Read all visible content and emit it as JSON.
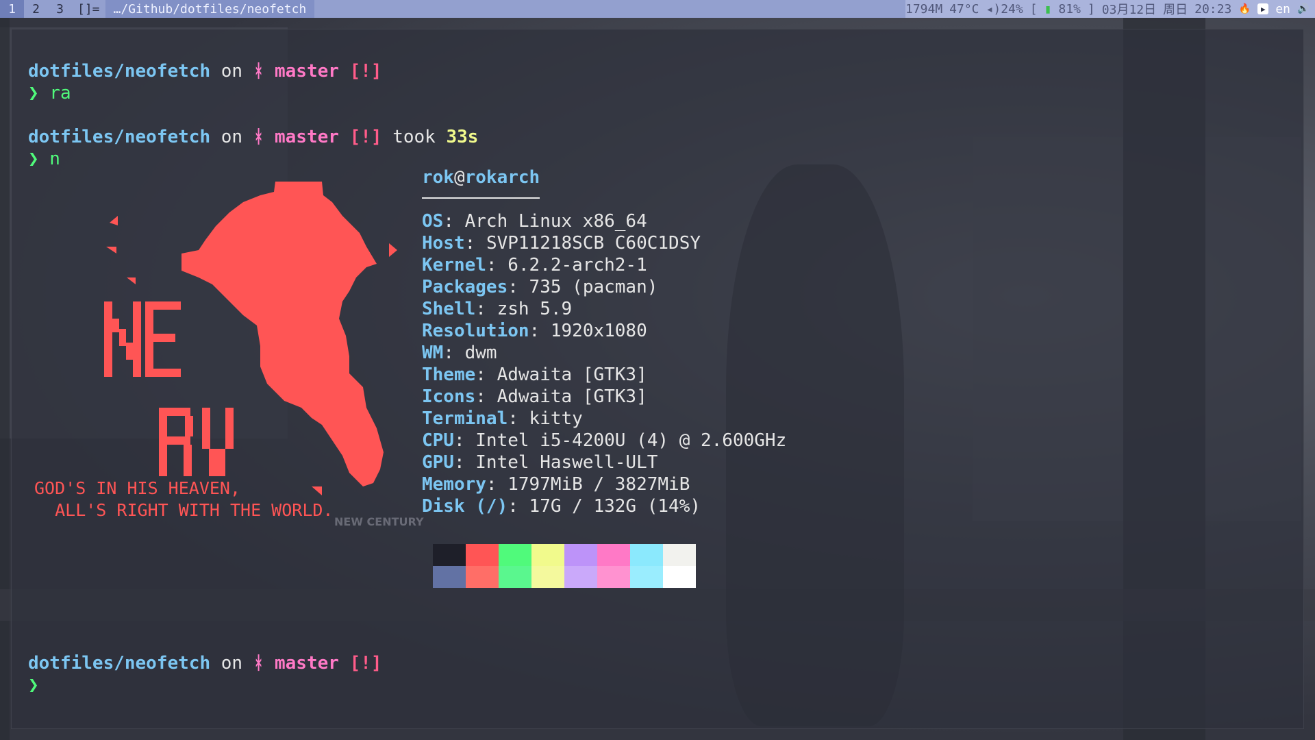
{
  "topbar": {
    "tags": [
      "1",
      "2",
      "3"
    ],
    "active_tag": "1",
    "layout_symbol": "[]=",
    "window_title": "…/Github/dotfiles/neofetch",
    "memory": "1794M",
    "temperature": "47°C",
    "volume": "◂)24%",
    "battery_open": "[",
    "battery": "81%",
    "battery_close": "]",
    "date": "03月12日",
    "weekday": "周日",
    "time": "20:23",
    "lang": "en",
    "icons": {
      "fire": "fire-icon",
      "play": "play-icon",
      "volume": "volume-icon",
      "battery": "battery-icon"
    }
  },
  "terminal": {
    "prompt1": {
      "dir": "dotfiles/neofetch",
      "on": " on ",
      "branch_icon": "ᚼ",
      "branch": " master",
      "status": " [!]"
    },
    "cmd1": {
      "prompt": "❯",
      "text": " ra"
    },
    "prompt2": {
      "dir": "dotfiles/neofetch",
      "on": " on ",
      "branch_icon": "ᚼ",
      "branch": " master",
      "status": " [!]",
      "took": " took ",
      "time": "33s"
    },
    "cmd2": {
      "prompt": "❯",
      "text": " n"
    },
    "prompt3": {
      "dir": "dotfiles/neofetch",
      "on": " on ",
      "branch_icon": "ᚼ",
      "branch": " master",
      "status": " [!]"
    },
    "cmd3": {
      "prompt": "❯",
      "text": ""
    }
  },
  "neofetch": {
    "user": "rok",
    "at": "@",
    "host": "rokarch",
    "rows": [
      {
        "key": "OS",
        "value": "Arch Linux x86_64"
      },
      {
        "key": "Host",
        "value": "SVP11218SCB C60C1DSY"
      },
      {
        "key": "Kernel",
        "value": "6.2.2-arch2-1"
      },
      {
        "key": "Packages",
        "value": "735 (pacman)"
      },
      {
        "key": "Shell",
        "value": "zsh 5.9"
      },
      {
        "key": "Resolution",
        "value": "1920x1080"
      },
      {
        "key": "WM",
        "value": "dwm"
      },
      {
        "key": "Theme",
        "value": "Adwaita [GTK3]"
      },
      {
        "key": "Icons",
        "value": "Adwaita [GTK3]"
      },
      {
        "key": "Terminal",
        "value": "kitty"
      },
      {
        "key": "CPU",
        "value": "Intel i5-4200U (4) @ 2.600GHz"
      },
      {
        "key": "GPU",
        "value": "Intel Haswell-ULT"
      },
      {
        "key": "Memory",
        "value": "1797MiB / 3827MiB"
      },
      {
        "key": "Disk (/)",
        "value": "17G / 132G (14%)"
      }
    ],
    "motto_line1": "GOD'S IN HIS HEAVEN,",
    "motto_line2": "  ALL'S RIGHT WITH THE WORLD.",
    "palette_top": [
      "#1e1f29",
      "#ff5555",
      "#50fa7b",
      "#f1fa8c",
      "#bd93f9",
      "#ff79c6",
      "#8be9fd",
      "#f2f2ee"
    ],
    "palette_bottom": [
      "#6272a4",
      "#ff6e67",
      "#5af78e",
      "#f4f99d",
      "#caa9fa",
      "#ff92d0",
      "#9aedfe",
      "#ffffff"
    ]
  },
  "wallpaper": {
    "watermark": "NEW CENTURY"
  }
}
